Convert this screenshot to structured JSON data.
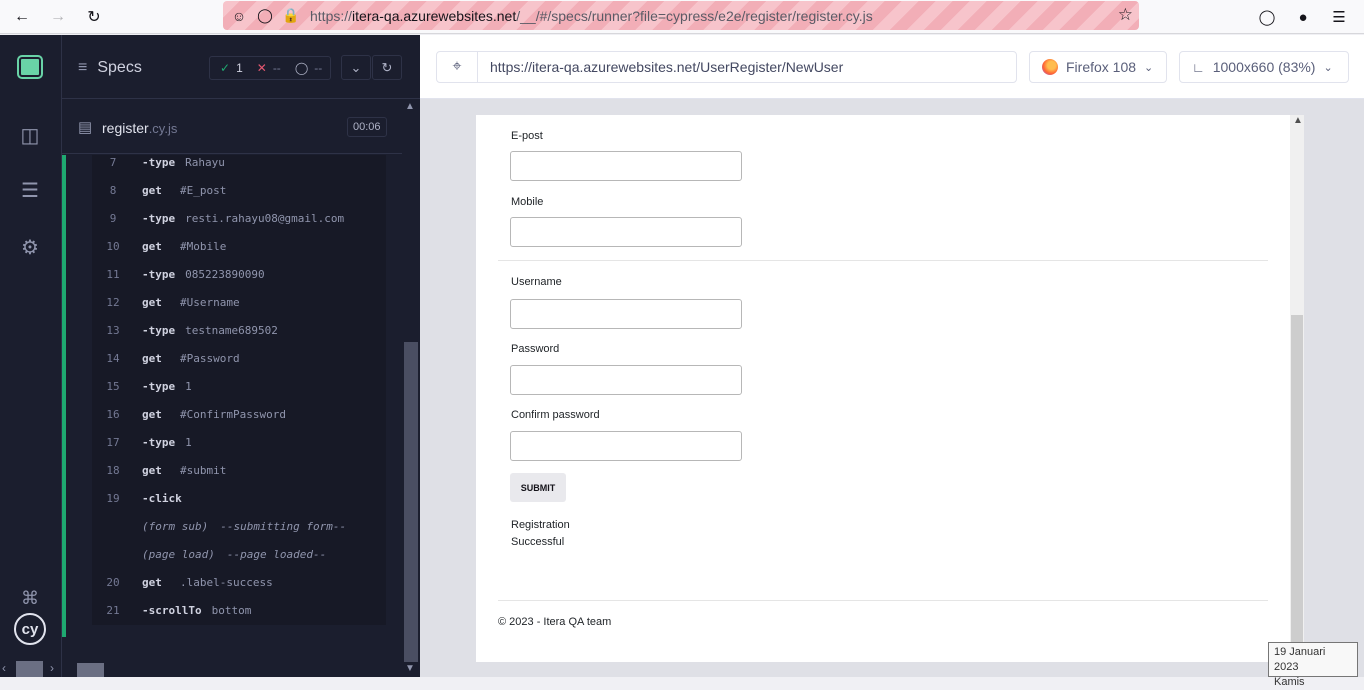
{
  "browser": {
    "url_prefix": "https://",
    "url_host": "itera-qa.azurewebsites.net",
    "url_path": "/__/#/specs/runner?file=cypress/e2e/register/register.cy.js"
  },
  "reporter": {
    "specs_label": "Specs",
    "passed_count": "1",
    "failed_count": "--",
    "pending_count": "--",
    "file_name": "register",
    "file_ext": ".cy.js",
    "duration": "00:06",
    "commands": [
      {
        "num": "7",
        "name": "-type",
        "msg": "Rahayu"
      },
      {
        "num": "8",
        "name": "get",
        "msg": "#E_post"
      },
      {
        "num": "9",
        "name": "-type",
        "msg": "resti.rahayu08@gmail.com"
      },
      {
        "num": "10",
        "name": "get",
        "msg": "#Mobile"
      },
      {
        "num": "11",
        "name": "-type",
        "msg": "085223890090"
      },
      {
        "num": "12",
        "name": "get",
        "msg": "#Username"
      },
      {
        "num": "13",
        "name": "-type",
        "msg": "testname689502"
      },
      {
        "num": "14",
        "name": "get",
        "msg": "#Password"
      },
      {
        "num": "15",
        "name": "-type",
        "msg": "1"
      },
      {
        "num": "16",
        "name": "get",
        "msg": "#ConfirmPassword"
      },
      {
        "num": "17",
        "name": "-type",
        "msg": "1"
      },
      {
        "num": "18",
        "name": "get",
        "msg": "#submit"
      },
      {
        "num": "19",
        "name": "-click",
        "msg": ""
      },
      {
        "num": "",
        "name": "",
        "label": "(form sub)",
        "msg": "--submitting form--"
      },
      {
        "num": "",
        "name": "",
        "label": "(page load)",
        "msg": "--page loaded--"
      },
      {
        "num": "20",
        "name": "get",
        "msg": ".label-success"
      },
      {
        "num": "21",
        "name": "-scrollTo",
        "msg": "bottom"
      }
    ]
  },
  "aut": {
    "url": "https://itera-qa.azurewebsites.net/UserRegister/NewUser",
    "browser_label": "Firefox 108",
    "viewport_label": "1000x660 (83%)"
  },
  "form": {
    "epost_label": "E-post",
    "mobile_label": "Mobile",
    "username_label": "Username",
    "password_label": "Password",
    "confirm_label": "Confirm password",
    "submit_label": "SUBMIT",
    "success_line1": "Registration",
    "success_line2": "Successful",
    "footer": "© 2023 - Itera QA team"
  },
  "tooltip": {
    "line1": "19 Januari 2023",
    "line2": "Kamis"
  },
  "colors": {
    "pass": "#1fa971",
    "fail": "#e45770",
    "sidebar_bg": "#1b1e2e"
  }
}
